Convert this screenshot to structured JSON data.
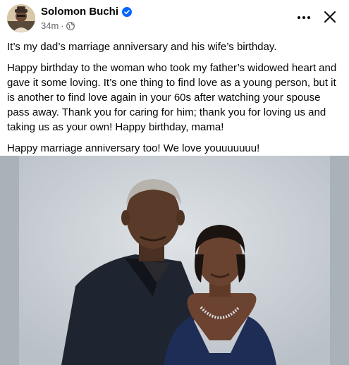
{
  "post": {
    "author_name": "Solomon Buchi",
    "timestamp": "34m",
    "separator": "·",
    "verified_icon": "verified-badge-icon",
    "privacy_icon": "globe-icon",
    "paragraphs": [
      "It’s my dad’s marriage anniversary and his wife’s birthday.",
      "Happy birthday to the woman who took my father’s widowed heart and gave it some loving. It’s one thing to find love as a young person, but it is another to find love again in your 60s after watching your spouse pass away. Thank you for caring for him; thank you for loving us and taking us as your own! Happy birthday, mama!",
      "Happy marriage anniversary too! We love youuuuuuu!"
    ]
  },
  "colors": {
    "text": "#050505",
    "secondary_text": "#65676b",
    "verified_blue": "#0866ff",
    "photo_border": "#a9b1b9"
  }
}
